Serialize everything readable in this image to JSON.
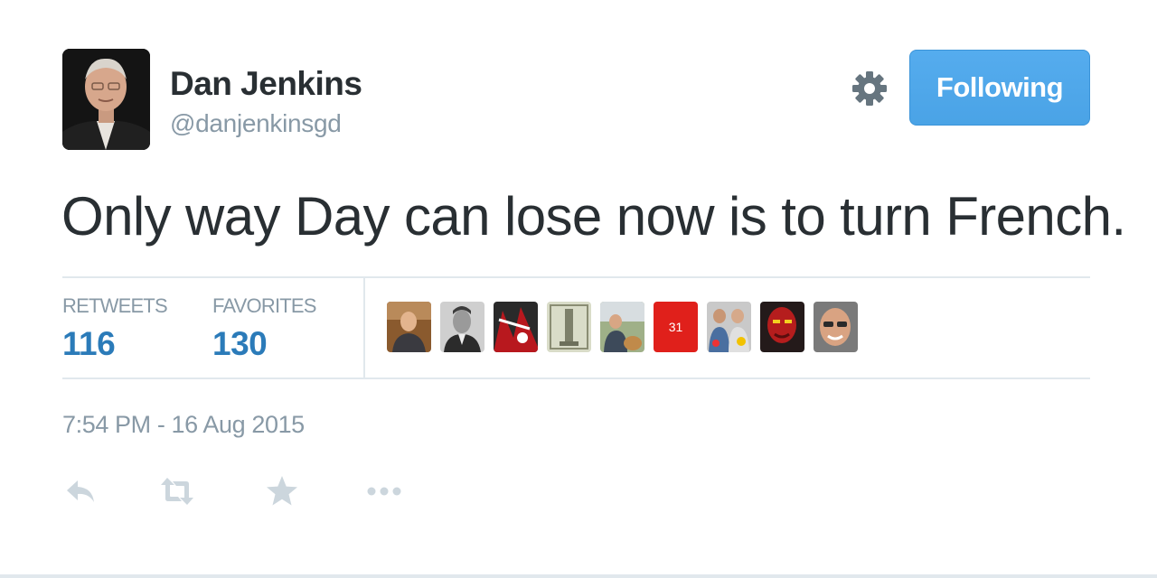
{
  "author": {
    "name": "Dan Jenkins",
    "handle": "@danjenkinsgd",
    "avatar_icon": "profile-photo"
  },
  "header": {
    "settings_icon": "gear-icon",
    "follow_label": "Following"
  },
  "tweet": {
    "text": "Only way Day can lose now is to turn French.",
    "timestamp": "7:54 PM - 16 Aug 2015"
  },
  "stats": {
    "retweets_label": "RETWEETS",
    "retweets_count": "116",
    "favorites_label": "FAVORITES",
    "favorites_count": "130"
  },
  "favoriters": [
    {
      "icon": "user-photo-1"
    },
    {
      "icon": "user-photo-2"
    },
    {
      "icon": "user-photo-3"
    },
    {
      "icon": "user-photo-4"
    },
    {
      "icon": "user-photo-5"
    },
    {
      "icon": "user-badge-31",
      "text": "31"
    },
    {
      "icon": "user-photo-7"
    },
    {
      "icon": "user-photo-8"
    },
    {
      "icon": "user-photo-9"
    }
  ],
  "actions": [
    {
      "name": "reply",
      "icon": "reply-icon"
    },
    {
      "name": "retweet",
      "icon": "retweet-icon"
    },
    {
      "name": "favorite",
      "icon": "star-icon"
    },
    {
      "name": "more",
      "icon": "ellipsis-icon"
    }
  ],
  "colors": {
    "accent": "#55acee",
    "count": "#2b7bb9",
    "muted": "#8899a6",
    "text": "#292f33",
    "border": "#e1e8ed"
  }
}
